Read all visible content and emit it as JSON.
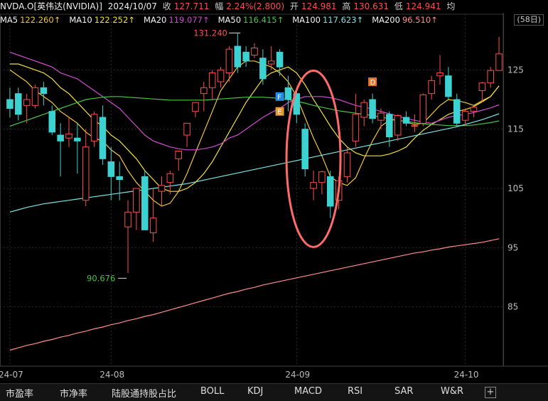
{
  "header": {
    "symbol": "NVDA.O[英伟达(NVIDIA)]",
    "date": "2024/10/07",
    "close_label": "收",
    "close": "127.711",
    "change_label": "幅",
    "change": "2.24%(2.800)",
    "open_label": "开",
    "open": "124.981",
    "high_label": "高",
    "high": "130.631",
    "low_label": "低",
    "low": "124.941",
    "avg_label": "均"
  },
  "ma_legend": [
    {
      "label": "MA5",
      "value": "122.260↑",
      "color": "#f5f5f5",
      "value_color": "#f2c53c"
    },
    {
      "label": "MA10",
      "value": "122.252↑",
      "color": "#f5f5f5",
      "value_color": "#f2e03c"
    },
    {
      "label": "MA20",
      "value": "119.077↑",
      "color": "#f5f5f5",
      "value_color": "#d24ad2"
    },
    {
      "label": "MA50",
      "value": "116.415↑",
      "color": "#f5f5f5",
      "value_color": "#48c648"
    },
    {
      "label": "MA100",
      "value": "117.623↑",
      "color": "#f5f5f5",
      "value_color": "#7fe3e3"
    },
    {
      "label": "MA200",
      "value": "96.510↑",
      "color": "#f5f5f5",
      "value_color": "#ff8c8c"
    }
  ],
  "range_button": "(58日)",
  "tabs": [
    "市盈率",
    "市净率",
    "陆股通持股占比",
    "BOLL",
    "KDJ",
    "MACD",
    "RSI",
    "SAR",
    "W&R"
  ],
  "tab_add": "+",
  "chart_data": {
    "type": "candlestick",
    "ylim": [
      75,
      132
    ],
    "y_ticks": [
      85,
      95,
      105,
      115,
      125
    ],
    "x_tick_labels": [
      "24-07",
      "24-08",
      "24-09",
      "24-10"
    ],
    "x_tick_index": [
      0,
      12,
      34,
      54
    ],
    "up_color": "#ff4d4d",
    "down_color": "#3cd2d2",
    "candles": [
      [
        120,
        122,
        117,
        118.5
      ],
      [
        121,
        122,
        116.5,
        117.5
      ],
      [
        119,
        121,
        116,
        120
      ],
      [
        119,
        122.5,
        118.5,
        122
      ],
      [
        122,
        123,
        119,
        121
      ],
      [
        118,
        119,
        114,
        114.5
      ],
      [
        114,
        116,
        107,
        113
      ],
      [
        113.5,
        117,
        112,
        114.2
      ],
      [
        113.5,
        116,
        107.5,
        113
      ],
      [
        103,
        115,
        102,
        112
      ],
      [
        113,
        118,
        112,
        117.5
      ],
      [
        117,
        119,
        109,
        110
      ],
      [
        109.5,
        112,
        103,
        107
      ],
      [
        107,
        109.5,
        103,
        106.5
      ],
      [
        98.5,
        103,
        90.7,
        101
      ],
      [
        101,
        105,
        98,
        105
      ],
      [
        107,
        108,
        98,
        98
      ],
      [
        97.5,
        105,
        96,
        100
      ],
      [
        104.5,
        107,
        102,
        105.5
      ],
      [
        106,
        108,
        104,
        107.5
      ],
      [
        110,
        111,
        108,
        111.3
      ],
      [
        114,
        116,
        112,
        116
      ],
      [
        118,
        119.5,
        117,
        119.5
      ],
      [
        121,
        123,
        118,
        122
      ],
      [
        122,
        125,
        120,
        124.5
      ],
      [
        123,
        125.5,
        122,
        125
      ],
      [
        124.5,
        129,
        123,
        128.5
      ],
      [
        129,
        131.2,
        124.5,
        125.5
      ],
      [
        128,
        129,
        125.5,
        126.5
      ],
      [
        127.5,
        129.5,
        127,
        128.7
      ],
      [
        127,
        128.5,
        122.5,
        123.5
      ],
      [
        126,
        129,
        125,
        126.5
      ],
      [
        128,
        128.5,
        124,
        125.5
      ],
      [
        122,
        124,
        118,
        120
      ],
      [
        121,
        122,
        116,
        117.5
      ],
      [
        115,
        116,
        107,
        108.3
      ],
      [
        105,
        108,
        103,
        106
      ],
      [
        106,
        108,
        104,
        107.8
      ],
      [
        107,
        108,
        100,
        102
      ],
      [
        103,
        107,
        101.5,
        106.3
      ],
      [
        107,
        112,
        106,
        111
      ],
      [
        113,
        121,
        112,
        117.5
      ],
      [
        117,
        120,
        115.5,
        119.5
      ],
      [
        120,
        121,
        116,
        116.8
      ],
      [
        116.5,
        118.5,
        115,
        117.7
      ],
      [
        117.5,
        118,
        112,
        113.7
      ],
      [
        114,
        117.5,
        113,
        117.3
      ],
      [
        117,
        118,
        115.5,
        116
      ],
      [
        115.5,
        117.5,
        114.5,
        115.6
      ],
      [
        116,
        121,
        115.5,
        120.8
      ],
      [
        121,
        124,
        120,
        123.2
      ],
      [
        124,
        127.5,
        122.5,
        124.5
      ],
      [
        124,
        125.5,
        120,
        120.5
      ],
      [
        120,
        121,
        115.5,
        116
      ],
      [
        116.5,
        118.5,
        115.5,
        118
      ],
      [
        118,
        119,
        117,
        118.7
      ],
      [
        121.5,
        123,
        119.5,
        122.8
      ],
      [
        122.8,
        125.5,
        122,
        124.9
      ],
      [
        124.9,
        130.6,
        124.9,
        127.7
      ]
    ],
    "ma_lines": [
      {
        "name": "MA5",
        "color": "#f2c53c",
        "values": [
          125,
          124,
          123,
          121.5,
          120.5,
          119.5,
          118,
          117,
          116,
          114.5,
          113.5,
          113,
          111.5,
          110.5,
          108,
          106,
          104.5,
          103,
          102,
          102.5,
          104.5,
          107.5,
          111,
          114.5,
          118,
          121.5,
          123.5,
          125.5,
          126.5,
          126.5,
          126,
          125.5,
          124.5,
          123,
          120.5,
          117,
          113.5,
          110.5,
          107,
          106,
          105.5,
          106.8,
          110,
          113,
          115.5,
          116.5,
          116.6,
          116.2,
          115.8,
          116,
          117.5,
          119,
          120,
          119.8,
          119.5,
          119,
          119.8,
          120.5,
          122.3
        ]
      },
      {
        "name": "MA10",
        "color": "#f2e03c",
        "values": [
          126,
          126,
          125.5,
          125,
          124.5,
          123.5,
          122,
          121,
          119.5,
          118,
          116.5,
          115.5,
          114,
          113,
          111.5,
          110,
          108,
          106.5,
          105,
          104.5,
          104.5,
          105,
          106,
          107.5,
          109.5,
          112,
          114.5,
          117,
          119.5,
          121.5,
          123.5,
          124.5,
          125,
          125.5,
          124.5,
          122.5,
          120,
          117.8,
          115.5,
          113.5,
          112,
          111,
          110.5,
          110.5,
          110.5,
          110.8,
          111.3,
          112,
          113.5,
          114.8,
          115.8,
          116.6,
          117.5,
          118,
          118.3,
          118.8,
          119.6,
          120.5,
          122.3
        ]
      },
      {
        "name": "MA20",
        "color": "#d24ad2",
        "values": [
          128,
          127.5,
          127,
          126.5,
          126,
          125.5,
          124.5,
          124,
          123.5,
          122.5,
          121.5,
          120.5,
          119.5,
          118.5,
          117,
          115.5,
          114,
          113,
          112.5,
          112,
          111.7,
          111.5,
          111.5,
          111.7,
          112,
          112.5,
          113.5,
          114,
          115,
          116,
          117,
          117.8,
          118.5,
          119.5,
          120,
          120.5,
          120.5,
          120.5,
          120.3,
          120,
          119.5,
          119,
          118.7,
          118.4,
          118,
          117.6,
          117.2,
          116.8,
          116.5,
          116.2,
          116,
          116.5,
          117,
          117.3,
          117.5,
          117.8,
          118.2,
          118.6,
          119.1
        ]
      },
      {
        "name": "MA50",
        "color": "#48c648",
        "values": [
          115.5,
          116,
          116.5,
          117,
          117.5,
          118,
          118.5,
          119,
          119.5,
          120,
          120.2,
          120.4,
          120.5,
          120.5,
          120.4,
          120.3,
          120.2,
          120.1,
          120,
          119.9,
          119.9,
          119.9,
          119.9,
          119.9,
          120,
          120.1,
          120.2,
          120.3,
          120.4,
          120.4,
          120.4,
          120.3,
          120.2,
          120,
          119.7,
          119.4,
          119,
          118.7,
          118.4,
          118.1,
          117.9,
          117.7,
          117.5,
          117.3,
          117,
          116.8,
          116.5,
          116.3,
          116.1,
          115.9,
          115.8,
          115.7,
          115.6,
          115.6,
          115.6,
          115.7,
          115.9,
          116.1,
          116.4
        ]
      },
      {
        "name": "MA100",
        "color": "#7fe3e3",
        "values": [
          101,
          101.4,
          101.8,
          102.1,
          102.4,
          102.6,
          102.8,
          103,
          103.2,
          103.4,
          103.6,
          103.8,
          104,
          104.2,
          104.4,
          104.6,
          104.8,
          105,
          105.2,
          105.4,
          105.6,
          105.8,
          106.1,
          106.4,
          106.7,
          107,
          107.3,
          107.6,
          107.9,
          108.2,
          108.5,
          108.8,
          109.1,
          109.4,
          109.7,
          110,
          110.3,
          110.6,
          110.9,
          111.2,
          111.5,
          111.8,
          112.1,
          112.4,
          112.7,
          113,
          113.3,
          113.6,
          113.9,
          114.2,
          114.5,
          114.8,
          115.1,
          115.4,
          115.8,
          116.2,
          116.6,
          117.1,
          117.6
        ]
      },
      {
        "name": "MA200",
        "color": "#ff8c8c",
        "values": [
          77.7,
          78.1,
          78.5,
          78.8,
          79.2,
          79.5,
          79.9,
          80.2,
          80.6,
          80.9,
          81.3,
          81.6,
          82,
          82.3,
          82.7,
          83,
          83.4,
          83.7,
          84.1,
          84.5,
          84.9,
          85.3,
          85.7,
          86.1,
          86.5,
          86.9,
          87.3,
          87.6,
          88,
          88.3,
          88.7,
          89,
          89.3,
          89.6,
          89.9,
          90.2,
          90.5,
          90.8,
          91.1,
          91.4,
          91.7,
          92,
          92.3,
          92.6,
          92.9,
          93.2,
          93.5,
          93.8,
          94.1,
          94.3,
          94.6,
          94.8,
          95.1,
          95.3,
          95.5,
          95.7,
          95.9,
          96.2,
          96.5
        ]
      }
    ],
    "high_annotation": {
      "label": "131.240",
      "index": 27,
      "value": 131.24
    },
    "low_annotation": {
      "label": "90.676",
      "index": 14,
      "value": 90.676
    },
    "event_markers": [
      {
        "label": "F",
        "index": 32,
        "value": 120.5,
        "color": "#2a8ae0"
      },
      {
        "label": "E",
        "index": 32,
        "value": 118,
        "color": "#e89a2a"
      },
      {
        "label": "D",
        "index": 43,
        "value": 123,
        "color": "#e8762a"
      }
    ],
    "highlight_ellipse": {
      "center_index": 36,
      "center_value": 110,
      "color": "#ff6b6b"
    }
  }
}
